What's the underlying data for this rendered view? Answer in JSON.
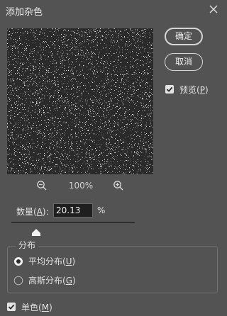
{
  "window": {
    "title": "添加杂色",
    "close_icon": "close-icon"
  },
  "preview": {
    "zoom_level": "100%",
    "zoom_out_icon": "zoom-out-icon",
    "zoom_in_icon": "zoom-in-icon"
  },
  "buttons": {
    "ok_label": "确定",
    "cancel_label": "取消"
  },
  "preview_option": {
    "label": "预览",
    "mnemonic": "P",
    "checked": true
  },
  "amount": {
    "label": "数量",
    "mnemonic": "A",
    "value": "20.13",
    "unit": "%",
    "slider_fraction": 0.2013
  },
  "distribution": {
    "legend": "分布",
    "options": [
      {
        "label": "平均分布",
        "mnemonic": "U",
        "selected": true
      },
      {
        "label": "高斯分布",
        "mnemonic": "G",
        "selected": false
      }
    ]
  },
  "monochromatic": {
    "label": "单色",
    "mnemonic": "M",
    "checked": true
  },
  "colors": {
    "background": "#535353",
    "preview_background": "#2a2a2a",
    "text": "#e0e0e0",
    "checkbox": "#e3e3e3"
  }
}
